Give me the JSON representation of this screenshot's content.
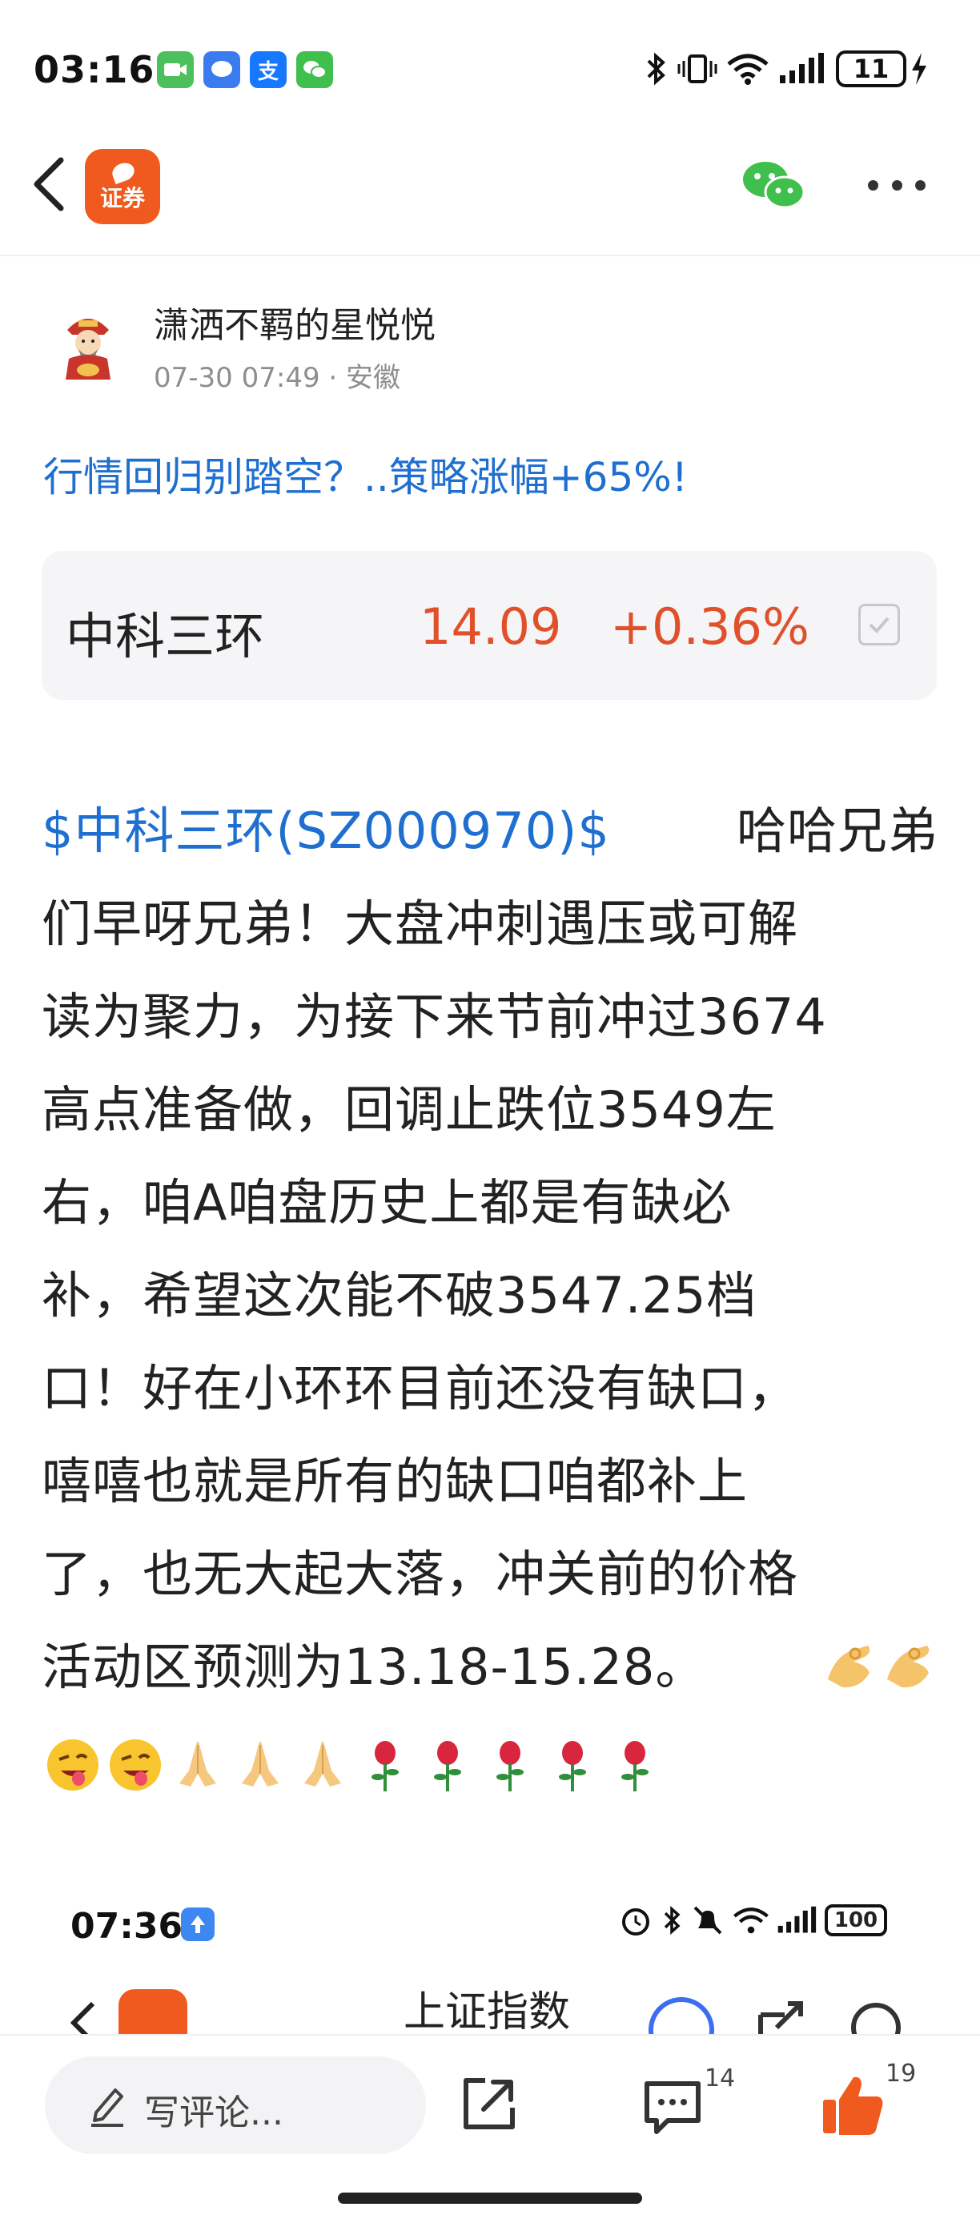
{
  "status_bar": {
    "time": "03:16",
    "alipay_label": "支",
    "battery": "11"
  },
  "header": {
    "logo_text": "证券"
  },
  "post": {
    "author": "潇洒不羁的星悦悦",
    "date": "07-30 07:49",
    "separator": "·",
    "location": "安徽",
    "headline": "行情回归别踏空？..策略涨幅+65%!",
    "stock": {
      "name": "中科三环",
      "price": "14.09",
      "change": "+0.36%"
    },
    "body": {
      "tag": "$中科三环(SZ000970)$",
      "lines": [
        "哈哈兄弟",
        "们早呀兄弟！大盘冲刺遇压或可解",
        "读为聚力，为接下来节前冲过3674",
        "高点准备做，回调止跌位3549左",
        "右，咱A咱盘历史上都是有缺必",
        "补，希望这次能不破3547.25档",
        "口！好在小环环目前还没有缺口，",
        "嘻嘻也就是所有的缺口咱都补上",
        "了，也无大起大落，冲关前的价格",
        "活动区预测为13.18-15.28。"
      ]
    },
    "emojis": [
      "ok-hand",
      "ok-hand",
      "winking-tongue-face",
      "winking-tongue-face",
      "folded-hands",
      "folded-hands",
      "folded-hands",
      "rose",
      "rose",
      "rose",
      "rose",
      "rose"
    ],
    "embedded_screenshot": {
      "time": "07:36",
      "battery": "100",
      "title": "上证指数"
    }
  },
  "bottom_bar": {
    "comment_placeholder": "写评论...",
    "comment_count": "14",
    "like_count": "19"
  },
  "colors": {
    "link_blue": "#1f6fd0",
    "price_red": "#e0512b",
    "brand_orange": "#f05a1e",
    "wechat_green": "#3fbf4b"
  }
}
